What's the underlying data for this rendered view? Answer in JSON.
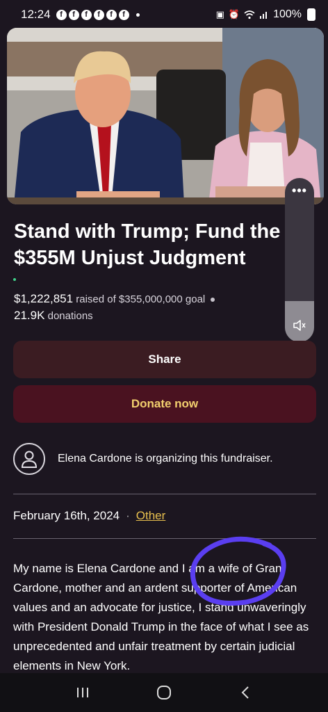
{
  "status_bar": {
    "time": "12:24",
    "battery": "100%",
    "notification_icon_count": 6
  },
  "campaign": {
    "title_line1": "Stand with Trump; Fund the",
    "title_line2": "$355M Unjust Judgment",
    "raised_amount": "$1,222,851",
    "goal_text": "raised of $355,000,000 goal",
    "donations_count": "21.9K",
    "donations_label": "donations",
    "progress_fraction": 0.0034
  },
  "actions": {
    "share_label": "Share",
    "donate_label": "Donate now"
  },
  "organizer": {
    "text": "Elena Cardone is organizing this fundraiser."
  },
  "meta": {
    "date": "February 16th, 2024",
    "separator": "·",
    "category": "Other"
  },
  "story": {
    "text": "My name is Elena Cardone and I am a wife of Grant Cardone, mother and an ardent supporter of American values and an advocate for justice, I stand unwaveringly with President Donald Trump in the face of what I see as unprecedented and unfair treatment by certain judicial elements in New York."
  },
  "overlay": {
    "menu_dots": "•••",
    "volume_level": 0.25
  },
  "colors": {
    "background": "#1c1620",
    "share_bg": "#3b1c22",
    "donate_bg": "#4a1220",
    "donate_text": "#f2cf6e",
    "link": "#e8c04e",
    "annotation": "#5a3ef0"
  },
  "icons": {
    "avatar": "person-icon",
    "volume": "speaker-icon",
    "nav_recent": "recent-apps-icon",
    "nav_home": "home-icon",
    "nav_back": "back-icon"
  }
}
